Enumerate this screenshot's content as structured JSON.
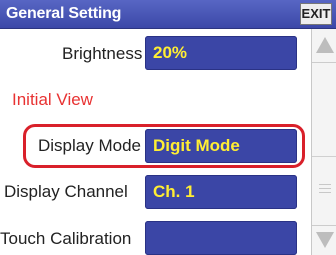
{
  "window": {
    "title": "General Setting",
    "exit_label": "EXIT"
  },
  "settings": {
    "brightness": {
      "label": "Brightness",
      "value": "20%"
    },
    "section_initial_view": "Initial View",
    "display_mode": {
      "label": "Display Mode",
      "value": "Digit Mode"
    },
    "display_channel": {
      "label": "Display Channel",
      "value": "Ch. 1"
    },
    "touch_calibration": {
      "label": "Touch Calibration",
      "value": ""
    }
  },
  "scrollbar": {
    "up_icon": "triangle-up",
    "down_icon": "triangle-down",
    "grip_icon": "grip-lines"
  },
  "colors": {
    "titlebar": "#3c48a8",
    "value_box": "#3b46a6",
    "value_text": "#ffee33",
    "section_title": "#e83232",
    "highlight": "#d9202a"
  }
}
